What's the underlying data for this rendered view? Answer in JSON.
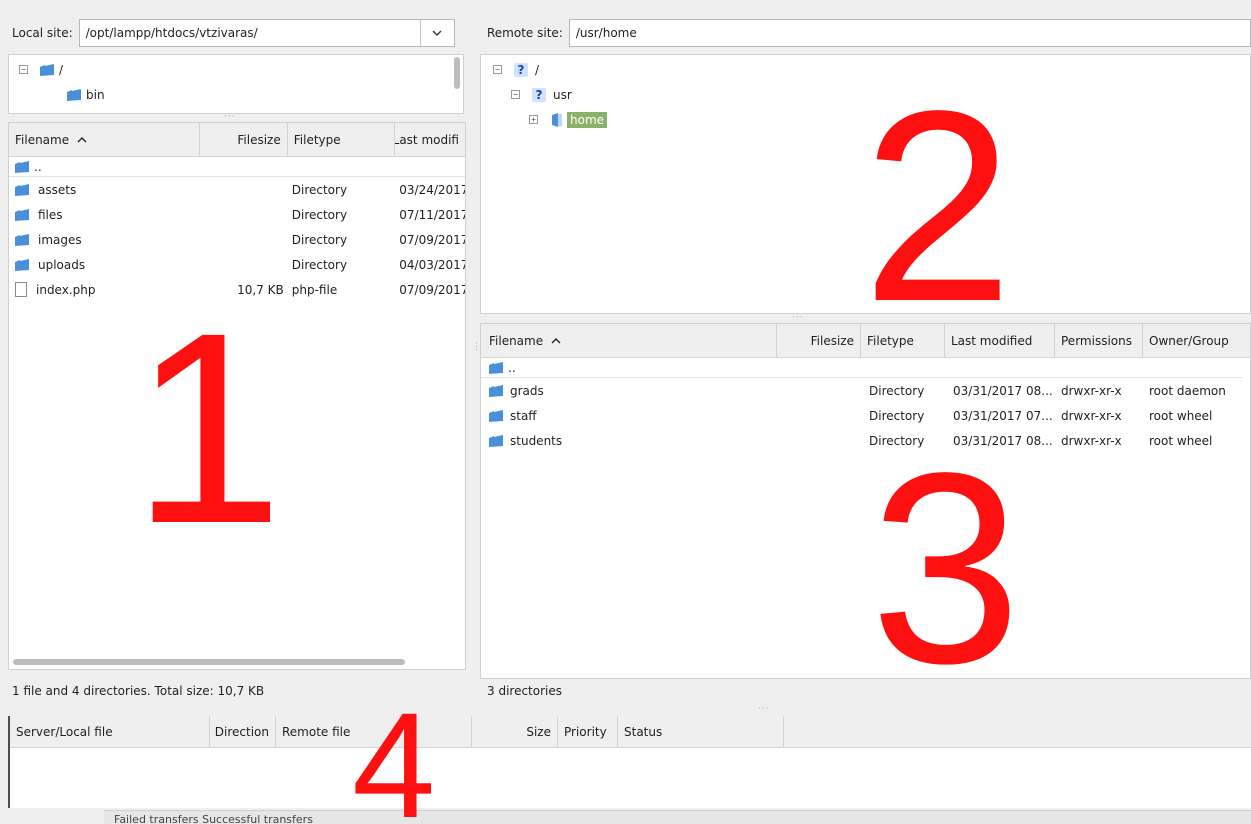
{
  "local": {
    "site_label": "Local site:",
    "path": "/opt/lampp/htdocs/vtzivaras/",
    "tree": [
      {
        "label": "/",
        "expander": "−"
      },
      {
        "label": "bin"
      }
    ],
    "columns": [
      "Filename",
      "Filesize",
      "Filetype",
      "Last modifi"
    ],
    "parent_row": "..",
    "rows": [
      {
        "name": "assets",
        "size": "",
        "type": "Directory",
        "modified": "03/24/2017"
      },
      {
        "name": "files",
        "size": "",
        "type": "Directory",
        "modified": "07/11/2017"
      },
      {
        "name": "images",
        "size": "",
        "type": "Directory",
        "modified": "07/09/2017"
      },
      {
        "name": "uploads",
        "size": "",
        "type": "Directory",
        "modified": "04/03/2017"
      },
      {
        "name": "index.php",
        "size": "10,7 KB",
        "type": "php-file",
        "modified": "07/09/2017"
      }
    ],
    "status": "1 file and 4 directories. Total size: 10,7 KB"
  },
  "remote": {
    "site_label": "Remote site:",
    "path": "/usr/home",
    "tree": [
      {
        "label": "/",
        "expander": "−"
      },
      {
        "label": "usr",
        "expander": "−"
      },
      {
        "label": "home",
        "expander": "+"
      }
    ],
    "columns": [
      "Filename",
      "Filesize",
      "Filetype",
      "Last modified",
      "Permissions",
      "Owner/Group"
    ],
    "parent_row": "..",
    "rows": [
      {
        "name": "grads",
        "size": "",
        "type": "Directory",
        "modified": "03/31/2017 08...",
        "perms": "drwxr-xr-x",
        "owner": "root daemon"
      },
      {
        "name": "staff",
        "size": "",
        "type": "Directory",
        "modified": "03/31/2017 07...",
        "perms": "drwxr-xr-x",
        "owner": "root wheel"
      },
      {
        "name": "students",
        "size": "",
        "type": "Directory",
        "modified": "03/31/2017 08...",
        "perms": "drwxr-xr-x",
        "owner": "root wheel"
      }
    ],
    "status": "3 directories"
  },
  "queue": {
    "columns": [
      "Server/Local file",
      "Direction",
      "Remote file",
      "Size",
      "Priority",
      "Status"
    ],
    "tabs_partial": "Failed transfers   Successful transfers"
  },
  "annotations": [
    "1",
    "2",
    "3",
    "4"
  ],
  "colors": {
    "annotation": "#ff1010",
    "selection": "#8ab06a",
    "folder": "#4a90d9"
  }
}
